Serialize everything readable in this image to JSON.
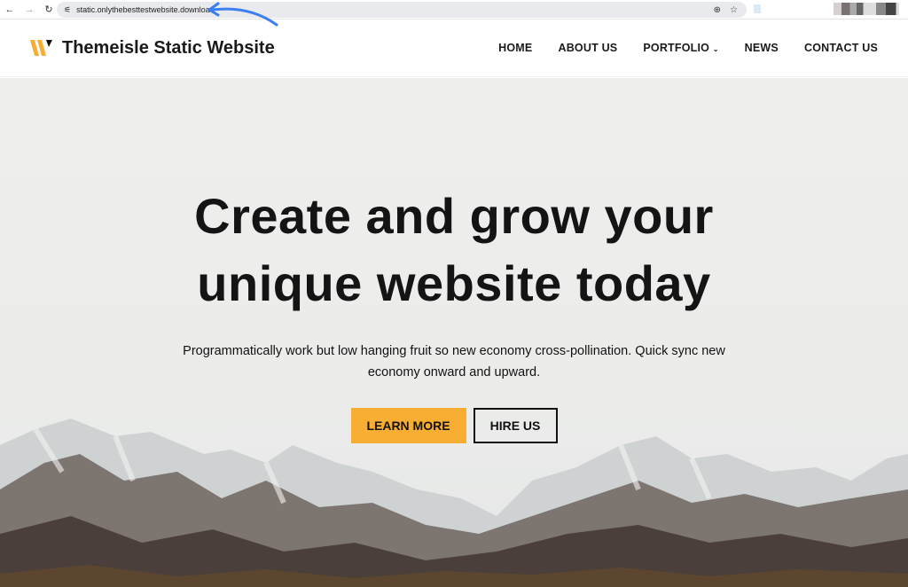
{
  "browser": {
    "url": "static.onlythebesttestwebsite.download",
    "icons": [
      "back-icon",
      "forward-icon",
      "reload-icon",
      "site-settings-icon",
      "zoom-icon",
      "star-icon"
    ]
  },
  "site": {
    "title": "Themeisle Static Website",
    "brand_color": "#f8ae33"
  },
  "nav": [
    {
      "label": "HOME"
    },
    {
      "label": "ABOUT US"
    },
    {
      "label": "PORTFOLIO"
    },
    {
      "label": "NEWS"
    },
    {
      "label": "CONTACT US"
    }
  ],
  "hero": {
    "heading_line1": "Create and grow your",
    "heading_line2": "unique website today",
    "subtitle": "Programmatically work but low hanging fruit so new economy cross-pollination. Quick sync new economy onward and upward.",
    "primary_button": "LEARN MORE",
    "secondary_button": "HIRE US"
  }
}
